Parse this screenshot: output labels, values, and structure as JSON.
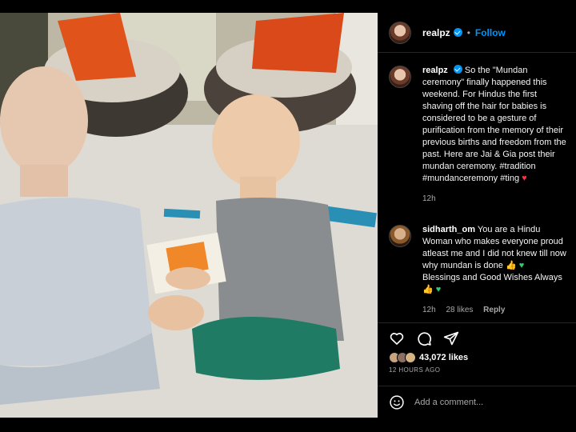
{
  "post": {
    "username": "realpz",
    "follow_label": "Follow",
    "separator": "•",
    "verified": true
  },
  "caption": {
    "username": "realpz",
    "text": "So the \"Mundan ceremony\" finally happened this weekend. For Hindus the first shaving off the hair for babies is considered to be a gesture of purification from the memory of their previous births and freedom from the past. Here are Jai & Gia post their mundan ceremony. #tradition #mundanceremony #ting",
    "emoji": "♥",
    "time": "12h"
  },
  "comments": [
    {
      "username": "sidharth_om",
      "text": "You are a Hindu Woman who makes everyone proud atleast me and I did not knew till now why mundan is done",
      "text_tail": "Blessings and Good Wishes Always",
      "time": "12h",
      "likes": "28 likes",
      "reply_label": "Reply"
    }
  ],
  "actions": {
    "like_icon": "heart-icon",
    "comment_icon": "comment-icon",
    "share_icon": "share-icon",
    "likes_count": "43,072 likes",
    "time_ago": "12 HOURS AGO"
  },
  "add_comment": {
    "placeholder": "Add a comment...",
    "emoji_icon": "smiley-icon"
  },
  "colors": {
    "accent": "#0095f6",
    "background": "#000000",
    "heart": "#ff3040",
    "green_heart": "#2ecc71"
  }
}
